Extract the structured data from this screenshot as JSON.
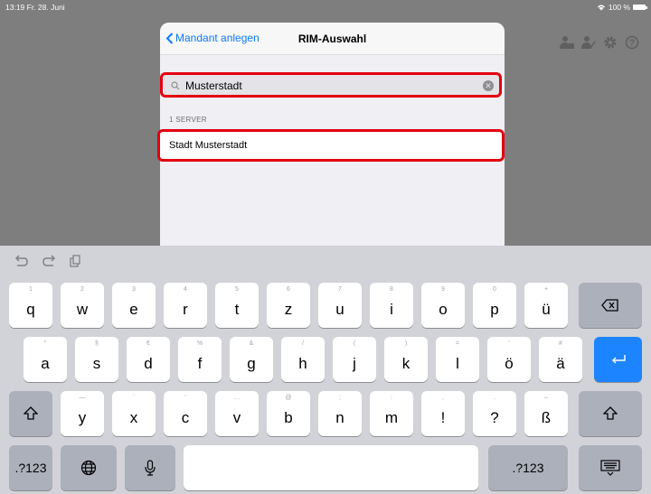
{
  "status_bar": {
    "time_date": "13:19  Fr. 28. Juni",
    "battery": "100 %"
  },
  "top_icons": [
    "person-lock-icon",
    "person-edit-icon",
    "gear-icon",
    "help-icon"
  ],
  "popover": {
    "back_label": "Mandant anlegen",
    "title": "RIM-Auswahl",
    "search_value": "Musterstadt",
    "section_header": "1 SERVER",
    "server_row": "Stadt Musterstadt"
  },
  "keyboard": {
    "row1": [
      {
        "main": "q",
        "alt": "1"
      },
      {
        "main": "w",
        "alt": "2"
      },
      {
        "main": "e",
        "alt": "3"
      },
      {
        "main": "r",
        "alt": "4"
      },
      {
        "main": "t",
        "alt": "5"
      },
      {
        "main": "z",
        "alt": "6"
      },
      {
        "main": "u",
        "alt": "7"
      },
      {
        "main": "i",
        "alt": "8"
      },
      {
        "main": "o",
        "alt": "9"
      },
      {
        "main": "p",
        "alt": "0"
      },
      {
        "main": "ü",
        "alt": "+"
      }
    ],
    "row2": [
      {
        "main": "a",
        "alt": "\""
      },
      {
        "main": "s",
        "alt": "§"
      },
      {
        "main": "d",
        "alt": "€"
      },
      {
        "main": "f",
        "alt": "%"
      },
      {
        "main": "g",
        "alt": "&"
      },
      {
        "main": "h",
        "alt": "/"
      },
      {
        "main": "j",
        "alt": "("
      },
      {
        "main": "k",
        "alt": ")"
      },
      {
        "main": "l",
        "alt": "="
      },
      {
        "main": "ö",
        "alt": "'"
      },
      {
        "main": "ä",
        "alt": "#"
      }
    ],
    "row3": [
      {
        "main": "y",
        "alt": "—"
      },
      {
        "main": "x",
        "alt": "`"
      },
      {
        "main": "c",
        "alt": "'"
      },
      {
        "main": "v",
        "alt": "…"
      },
      {
        "main": "b",
        "alt": "@"
      },
      {
        "main": "n",
        "alt": ";"
      },
      {
        "main": "m",
        "alt": ":"
      },
      {
        "main": "!",
        "alt": ","
      },
      {
        "main": "?",
        "alt": "."
      },
      {
        "main": "ß",
        "alt": "–"
      }
    ],
    "numbers_label": ".?123",
    "numbers_label_right": ".?123"
  }
}
